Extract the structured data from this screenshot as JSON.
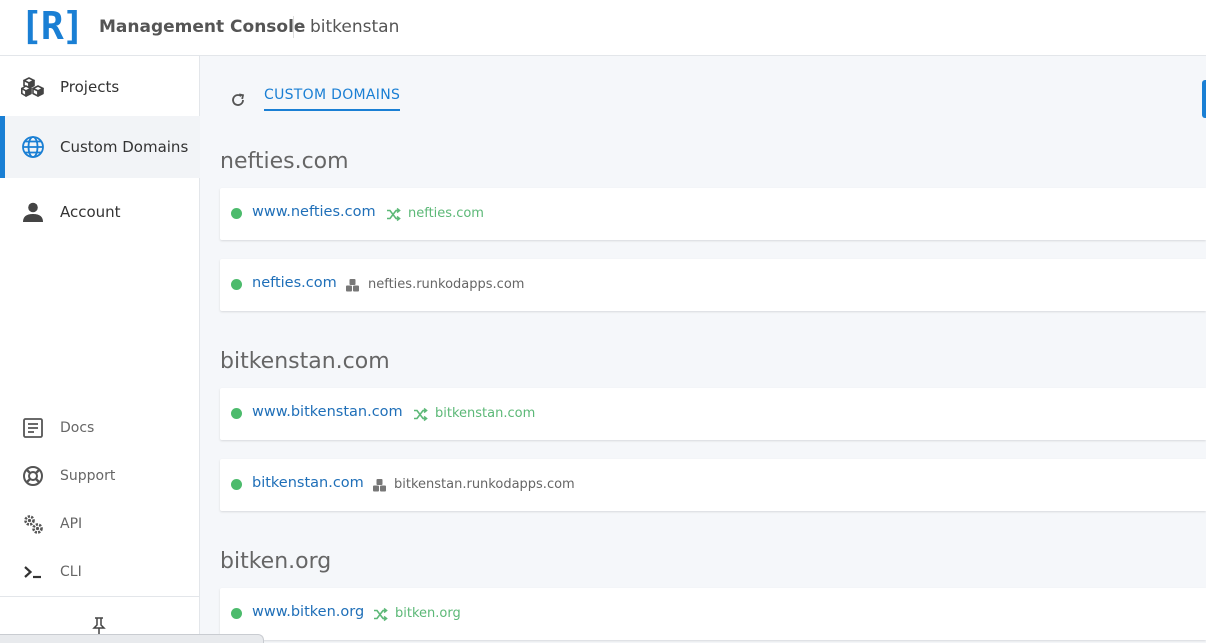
{
  "header": {
    "logo": "[R]",
    "app_title": "Management Console",
    "account": "bitkenstan"
  },
  "sidebar": {
    "primary": [
      {
        "label": "Projects",
        "icon": "cubes-icon",
        "active": false
      },
      {
        "label": "Custom Domains",
        "icon": "globe-icon",
        "active": true
      },
      {
        "label": "Account",
        "icon": "user-icon",
        "active": false
      }
    ],
    "secondary": [
      {
        "label": "Docs",
        "icon": "document-icon"
      },
      {
        "label": "Support",
        "icon": "lifebuoy-icon"
      },
      {
        "label": "API",
        "icon": "gears-icon"
      },
      {
        "label": "CLI",
        "icon": "terminal-icon"
      }
    ],
    "pin_icon": "pin-icon"
  },
  "main": {
    "tab_label": "CUSTOM DOMAINS",
    "groups": [
      {
        "title": "nefties.com",
        "domains": [
          {
            "name": "www.nefties.com",
            "target": "nefties.com",
            "type": "redirect"
          },
          {
            "name": "nefties.com",
            "target": "nefties.runkodapps.com",
            "type": "app"
          }
        ]
      },
      {
        "title": "bitkenstan.com",
        "domains": [
          {
            "name": "www.bitkenstan.com",
            "target": "bitkenstan.com",
            "type": "redirect"
          },
          {
            "name": "bitkenstan.com",
            "target": "bitkenstan.runkodapps.com",
            "type": "app"
          }
        ]
      },
      {
        "title": "bitken.org",
        "domains": [
          {
            "name": "www.bitken.org",
            "target": "bitken.org",
            "type": "redirect"
          }
        ]
      }
    ]
  },
  "colors": {
    "accent": "#1a7fd4",
    "link": "#1f6fb8",
    "status_active": "#4cbb6c",
    "redirect_text": "#5cb877",
    "app_text": "#666666"
  }
}
